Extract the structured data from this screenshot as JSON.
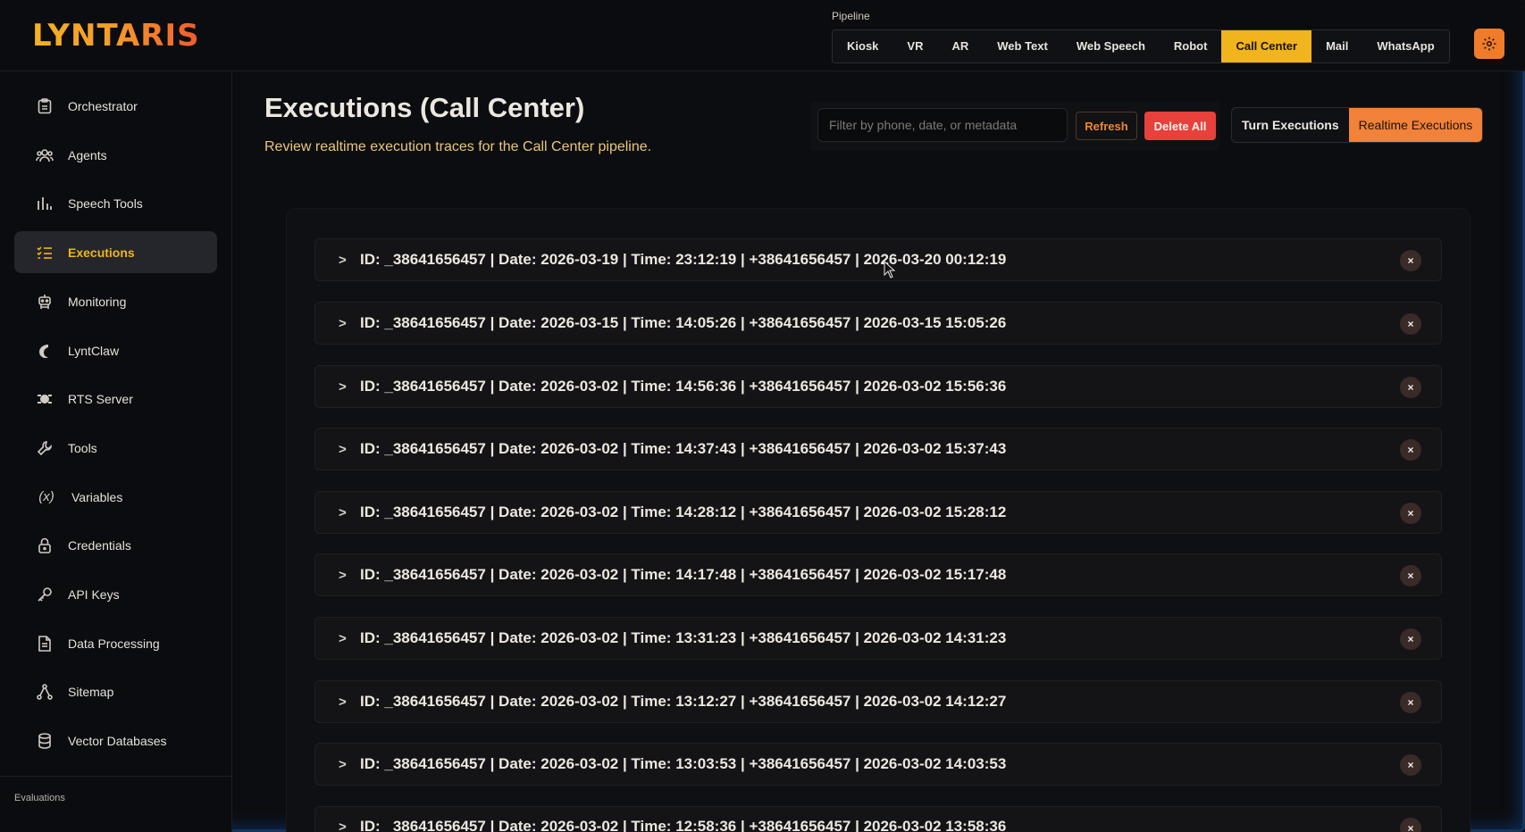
{
  "app": {
    "logo": "LYNTARIS"
  },
  "pipeline": {
    "label": "Pipeline",
    "tabs": [
      "Kiosk",
      "VR",
      "AR",
      "Web Text",
      "Web Speech",
      "Robot",
      "Call Center",
      "Mail",
      "WhatsApp"
    ],
    "active": "Call Center"
  },
  "sidebar": {
    "items": [
      {
        "label": "Orchestrator",
        "icon": "clipboard-icon"
      },
      {
        "label": "Agents",
        "icon": "users-icon"
      },
      {
        "label": "Speech Tools",
        "icon": "bar-chart-icon"
      },
      {
        "label": "Executions",
        "icon": "list-icon",
        "active": true
      },
      {
        "label": "Monitoring",
        "icon": "robot-icon"
      },
      {
        "label": "LyntClaw",
        "icon": "claw-icon"
      },
      {
        "label": "RTS Server",
        "icon": "server-icon"
      },
      {
        "label": "Tools",
        "icon": "wrench-icon"
      },
      {
        "label": "Variables",
        "icon": "variable-icon"
      },
      {
        "label": "Credentials",
        "icon": "lock-icon"
      },
      {
        "label": "API Keys",
        "icon": "key-icon"
      },
      {
        "label": "Data Processing",
        "icon": "document-icon"
      },
      {
        "label": "Sitemap",
        "icon": "sitemap-icon"
      },
      {
        "label": "Vector Databases",
        "icon": "database-icon"
      }
    ],
    "section": "Evaluations"
  },
  "main": {
    "title": "Executions (Call Center)",
    "subtitle": "Review realtime execution traces for the Call Center pipeline.",
    "filter_placeholder": "Filter by phone, date, or metadata",
    "refresh_label": "Refresh",
    "delete_all_label": "Delete All",
    "modes": [
      "Turn Executions",
      "Realtime Executions"
    ],
    "active_mode": "Realtime Executions"
  },
  "executions": [
    {
      "text": "ID: _38641656457 | Date: 2026-03-19 | Time: 23:12:19 | +38641656457 | 2026-03-20 00:12:19"
    },
    {
      "text": "ID: _38641656457 | Date: 2026-03-15 | Time: 14:05:26 | +38641656457 | 2026-03-15 15:05:26"
    },
    {
      "text": "ID: _38641656457 | Date: 2026-03-02 | Time: 14:56:36 | +38641656457 | 2026-03-02 15:56:36"
    },
    {
      "text": "ID: _38641656457 | Date: 2026-03-02 | Time: 14:37:43 | +38641656457 | 2026-03-02 15:37:43"
    },
    {
      "text": "ID: _38641656457 | Date: 2026-03-02 | Time: 14:28:12 | +38641656457 | 2026-03-02 15:28:12"
    },
    {
      "text": "ID: _38641656457 | Date: 2026-03-02 | Time: 14:17:48 | +38641656457 | 2026-03-02 15:17:48"
    },
    {
      "text": "ID: _38641656457 | Date: 2026-03-02 | Time: 13:31:23 | +38641656457 | 2026-03-02 14:31:23"
    },
    {
      "text": "ID: _38641656457 | Date: 2026-03-02 | Time: 13:12:27 | +38641656457 | 2026-03-02 14:12:27"
    },
    {
      "text": "ID: _38641656457 | Date: 2026-03-02 | Time: 13:03:53 | +38641656457 | 2026-03-02 14:03:53"
    },
    {
      "text": "ID: _38641656457 | Date: 2026-03-02 | Time: 12:58:36 | +38641656457 | 2026-03-02 13:58:36"
    }
  ],
  "row_caret": ">",
  "row_close": "×"
}
